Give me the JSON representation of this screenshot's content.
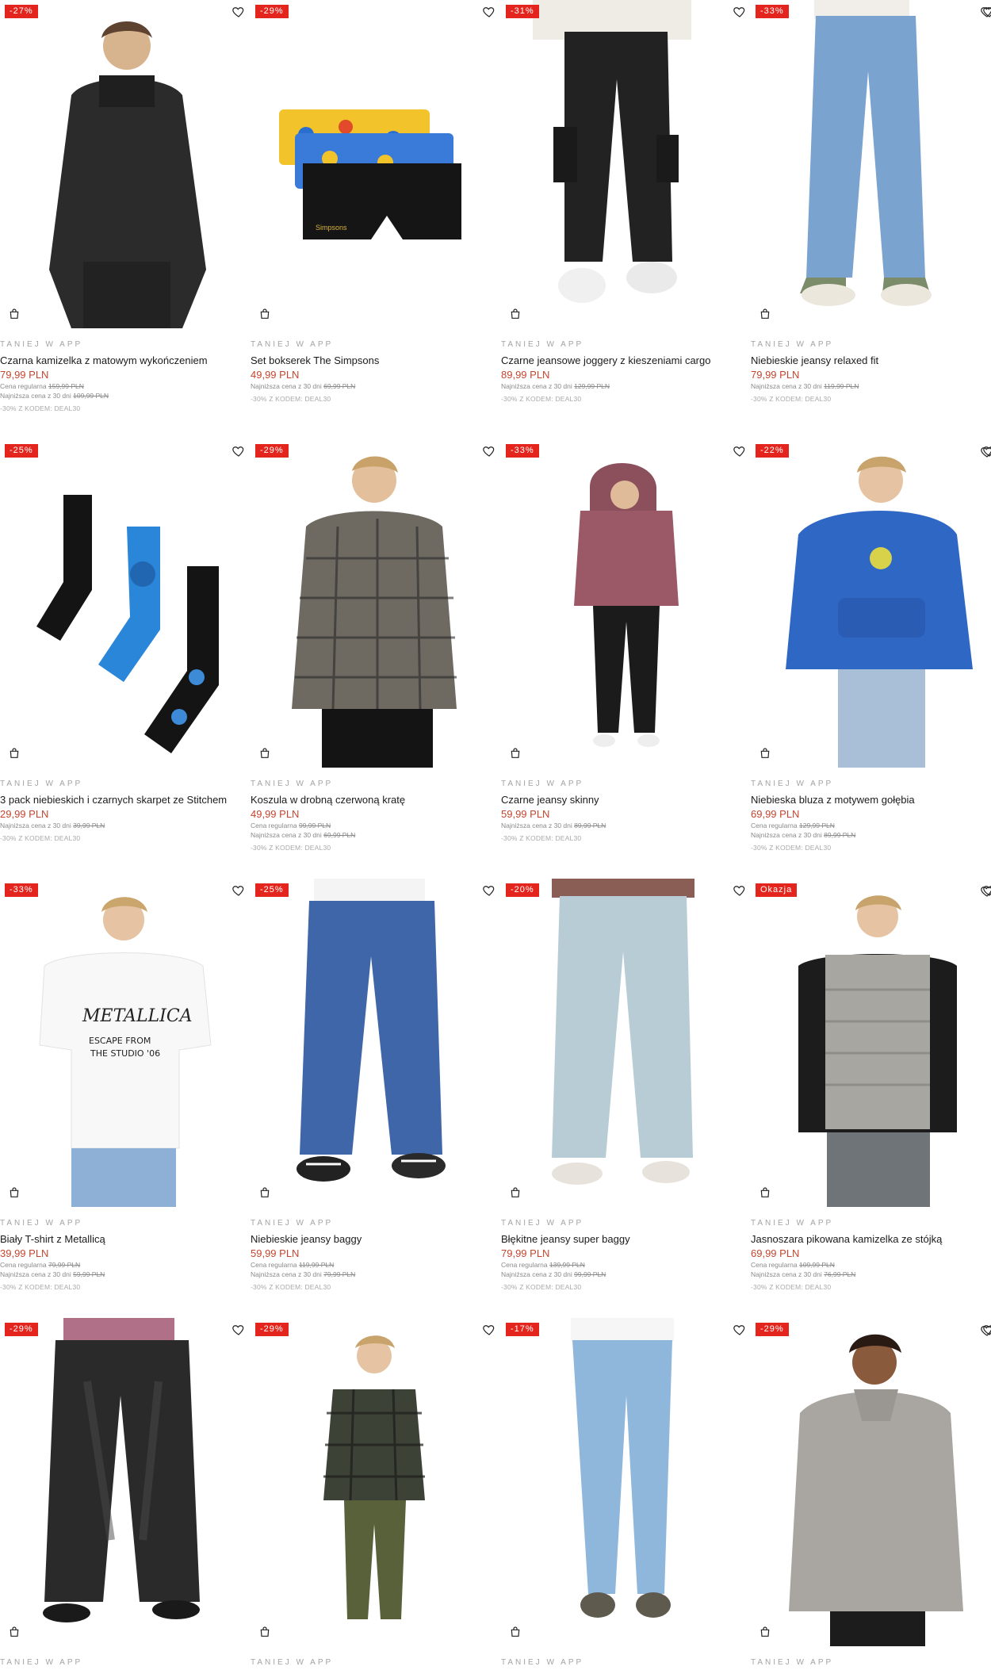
{
  "colors": {
    "badge": "#e3251d",
    "price": "#c4452f",
    "promo": "#a3a3a3"
  },
  "products": [
    {
      "badge": "-27%",
      "promo": "TANIEJ W APP",
      "name": "Czarna kamizelka z matowym wykończeniem",
      "price": "79,99 PLN",
      "regular_label": "Cena regularna",
      "regular_price": "159,99 PLN",
      "lowest_label": "Najniższa cena z 30 dni",
      "lowest_price": "109,99 PLN",
      "code": "-30% Z KODEM: DEAL30",
      "image": "black-vest-model"
    },
    {
      "badge": "-29%",
      "promo": "TANIEJ W APP",
      "name": "Set bokserek The Simpsons",
      "price": "49,99 PLN",
      "regular_label": "",
      "regular_price": "",
      "lowest_label": "Najniższa cena z 30 dni",
      "lowest_price": "69,99 PLN",
      "code": "-30% Z KODEM: DEAL30",
      "image": "simpsons-boxers"
    },
    {
      "badge": "-31%",
      "promo": "TANIEJ W APP",
      "name": "Czarne jeansowe joggery z kieszeniami cargo",
      "price": "89,99 PLN",
      "regular_label": "",
      "regular_price": "",
      "lowest_label": "Najniższa cena z 30 dni",
      "lowest_price": "129,99 PLN",
      "code": "-30% Z KODEM: DEAL30",
      "image": "black-cargo-joggers"
    },
    {
      "badge": "-33%",
      "promo": "TANIEJ W APP",
      "name": "Niebieskie jeansy relaxed fit",
      "price": "79,99 PLN",
      "regular_label": "",
      "regular_price": "",
      "lowest_label": "Najniższa cena z 30 dni",
      "lowest_price": "119,99 PLN",
      "code": "-30% Z KODEM: DEAL30",
      "image": "blue-relaxed-jeans"
    },
    {
      "badge": "-25%",
      "promo": "TANIEJ W APP",
      "name": "3 pack niebieskich i czarnych skarpet ze Stitchem",
      "price": "29,99 PLN",
      "regular_label": "",
      "regular_price": "",
      "lowest_label": "Najniższa cena z 30 dni",
      "lowest_price": "39,99 PLN",
      "code": "-30% Z KODEM: DEAL30",
      "image": "stitch-socks"
    },
    {
      "badge": "-29%",
      "promo": "TANIEJ W APP",
      "name": "Koszula w drobną czerwoną kratę",
      "price": "49,99 PLN",
      "regular_label": "Cena regularna",
      "regular_price": "99,99 PLN",
      "lowest_label": "Najniższa cena z 30 dni",
      "lowest_price": "69,99 PLN",
      "code": "-30% Z KODEM: DEAL30",
      "image": "plaid-shirt-model"
    },
    {
      "badge": "-33%",
      "promo": "TANIEJ W APP",
      "name": "Czarne jeansy skinny",
      "price": "59,99 PLN",
      "regular_label": "",
      "regular_price": "",
      "lowest_label": "Najniższa cena z 30 dni",
      "lowest_price": "89,99 PLN",
      "code": "-30% Z KODEM: DEAL30",
      "image": "black-skinny-jeans"
    },
    {
      "badge": "-22%",
      "promo": "TANIEJ W APP",
      "name": "Niebieska bluza z motywem gołębia",
      "price": "69,99 PLN",
      "regular_label": "Cena regularna",
      "regular_price": "129,99 PLN",
      "lowest_label": "Najniższa cena z 30 dni",
      "lowest_price": "89,99 PLN",
      "code": "-30% Z KODEM: DEAL30",
      "image": "blue-hoodie-model"
    },
    {
      "badge": "-33%",
      "promo": "TANIEJ W APP",
      "name": "Biały T-shirt z Metallicą",
      "price": "39,99 PLN",
      "regular_label": "Cena regularna",
      "regular_price": "79,99 PLN",
      "lowest_label": "Najniższa cena z 30 dni",
      "lowest_price": "59,99 PLN",
      "code": "-30% Z KODEM: DEAL30",
      "image": "metallica-tshirt-model"
    },
    {
      "badge": "-25%",
      "promo": "TANIEJ W APP",
      "name": "Niebieskie jeansy baggy",
      "price": "59,99 PLN",
      "regular_label": "Cena regularna",
      "regular_price": "119,99 PLN",
      "lowest_label": "Najniższa cena z 30 dni",
      "lowest_price": "79,99 PLN",
      "code": "-30% Z KODEM: DEAL30",
      "image": "baggy-jeans"
    },
    {
      "badge": "-20%",
      "promo": "TANIEJ W APP",
      "name": "Błękitne jeansy super baggy",
      "price": "79,99 PLN",
      "regular_label": "Cena regularna",
      "regular_price": "139,99 PLN",
      "lowest_label": "Najniższa cena z 30 dni",
      "lowest_price": "99,99 PLN",
      "code": "-30% Z KODEM: DEAL30",
      "image": "light-baggy-jeans"
    },
    {
      "badge": "Okazja",
      "promo": "TANIEJ W APP",
      "name": "Jasnoszara pikowana kamizelka ze stójką",
      "price": "69,99 PLN",
      "regular_label": "Cena regularna",
      "regular_price": "109,99 PLN",
      "lowest_label": "Najniższa cena z 30 dni",
      "lowest_price": "76,99 PLN",
      "code": "-30% Z KODEM: DEAL30",
      "image": "grey-puffer-vest-model"
    },
    {
      "badge": "-29%",
      "promo": "TANIEJ W APP",
      "name": "",
      "price": "",
      "regular_label": "",
      "regular_price": "",
      "lowest_label": "",
      "lowest_price": "",
      "code": "",
      "image": "black-wide-jeans"
    },
    {
      "badge": "-29%",
      "promo": "TANIEJ W APP",
      "name": "",
      "price": "",
      "regular_label": "",
      "regular_price": "",
      "lowest_label": "",
      "lowest_price": "",
      "code": "",
      "image": "plaid-jacket-model"
    },
    {
      "badge": "-17%",
      "promo": "TANIEJ W APP",
      "name": "",
      "price": "",
      "regular_label": "",
      "regular_price": "",
      "lowest_label": "",
      "lowest_price": "",
      "code": "",
      "image": "light-skinny-jeans"
    },
    {
      "badge": "-29%",
      "promo": "TANIEJ W APP",
      "name": "",
      "price": "",
      "regular_label": "",
      "regular_price": "",
      "lowest_label": "",
      "lowest_price": "",
      "code": "",
      "image": "grey-jacket-model"
    }
  ]
}
